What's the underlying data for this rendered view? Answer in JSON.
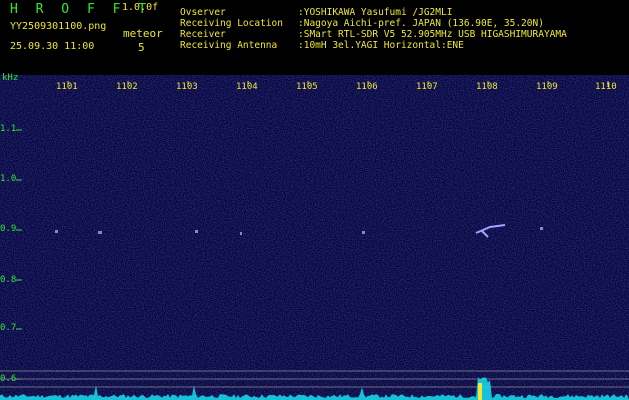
{
  "header": {
    "app_title": "H R O F F T",
    "version": "1.0.0f",
    "file_name": "YY2509301100.png",
    "datetime": "25.09.30 11:00",
    "meteor_label": "meteor",
    "meteor_count": "5",
    "info": [
      {
        "label": "Ovserver",
        "value": ":YOSHIKAWA Yasufumi /JG2MLI"
      },
      {
        "label": "Receiving Location",
        "value": ":Nagoya Aichi-pref. JAPAN (136.90E, 35.20N)"
      },
      {
        "label": "Receiver",
        "value": ":SMart RTL-SDR V5 52.905MHz USB HIGASHIMURAYAMA"
      },
      {
        "label": "Receiving Antenna",
        "value": ":10mH 3el.YAGI Horizontal:ENE"
      }
    ]
  },
  "axes": {
    "y_unit": "kHz",
    "y_ticks": [
      "1.1",
      "1.0",
      "0.9",
      "0.8",
      "0.7",
      "0.6"
    ],
    "x_ticks": [
      "1101",
      "1102",
      "1103",
      "1104",
      "1105",
      "1106",
      "1107",
      "1108",
      "1109",
      "1110"
    ]
  },
  "colors": {
    "background": "#000000",
    "spectrum": "#0a0a55",
    "header_text": "#2ee82e",
    "info_text": "#f0e832",
    "trace": "#17e0f0",
    "signal": "#9aa6ff"
  }
}
